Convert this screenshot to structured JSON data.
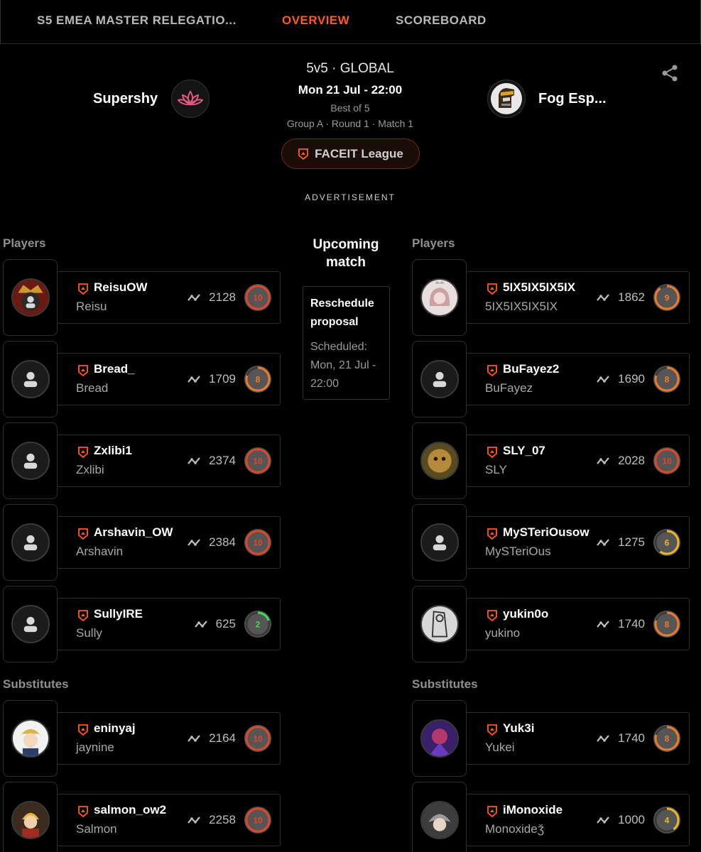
{
  "tabs": [
    {
      "label": "S5 EMEA MASTER RELEGATIO..."
    },
    {
      "label": "OVERVIEW",
      "active": true
    },
    {
      "label": "SCOREBOARD"
    }
  ],
  "match": {
    "team1": {
      "name": "Supershy",
      "logo_icon": "lotus-icon"
    },
    "team2": {
      "name": "Fog Esp...",
      "logo_icon": "knight-helmet-icon"
    },
    "format": "5v5 · GLOBAL",
    "datetime": "Mon 21 Jul - 22:00",
    "best_of": "Best of 5",
    "group_info": "Group A · Round 1 · Match 1",
    "league": "FACEIT League",
    "advertisement": "ADVERTISEMENT"
  },
  "center": {
    "upcoming_label": "Upcoming match",
    "reschedule_title": "Reschedule proposal",
    "reschedule_body": "Scheduled: Mon, 21 Jul - 22:00"
  },
  "labels": {
    "players": "Players",
    "substitutes": "Substitutes"
  },
  "colors": {
    "accent": "#ff5a1f",
    "level_red": "#e0462a",
    "level_orange": "#f07a2c",
    "level_yellow": "#f0b429",
    "level_green": "#3ddc52"
  },
  "team1_players": [
    {
      "nick": "ReisuOW",
      "name": "Reisu",
      "elo": "2128",
      "level": "10",
      "avatar": "crown-photo"
    },
    {
      "nick": "Bread_",
      "name": "Bread",
      "elo": "1709",
      "level": "8",
      "avatar": "default"
    },
    {
      "nick": "Zxlibi1",
      "name": "Zxlibi",
      "elo": "2374",
      "level": "10",
      "avatar": "default"
    },
    {
      "nick": "Arshavin_OW",
      "name": "Arshavin",
      "elo": "2384",
      "level": "10",
      "avatar": "default"
    },
    {
      "nick": "SullyIRE",
      "name": "Sully",
      "elo": "625",
      "level": "2",
      "avatar": "default"
    }
  ],
  "team1_subs": [
    {
      "nick": "eninyaj",
      "name": "jaynine",
      "elo": "2164",
      "level": "10",
      "avatar": "anime-photo"
    },
    {
      "nick": "salmon_ow2",
      "name": "Salmon",
      "elo": "2258",
      "level": "10",
      "avatar": "alchemist-photo"
    }
  ],
  "team2_players": [
    {
      "nick": "5IX5IX5IX5IX",
      "name": "5IX5IX5IX5IX",
      "elo": "1862",
      "level": "9",
      "avatar": "girl-photo"
    },
    {
      "nick": "BuFayez2",
      "name": "BuFayez",
      "elo": "1690",
      "level": "8",
      "avatar": "default"
    },
    {
      "nick": "SLY_07",
      "name": "SLY",
      "elo": "2028",
      "level": "10",
      "avatar": "cat-photo"
    },
    {
      "nick": "MySTeriOusow",
      "name": "MySTeriOus",
      "elo": "1275",
      "level": "6",
      "avatar": "default"
    },
    {
      "nick": "yukin0o",
      "name": "yukino",
      "elo": "1740",
      "level": "8",
      "avatar": "sketch-photo"
    }
  ],
  "team2_subs": [
    {
      "nick": "Yuk3i",
      "name": "Yukei",
      "elo": "1740",
      "level": "8",
      "avatar": "purple-photo"
    },
    {
      "nick": "iMonoxide",
      "name": "Monoxideǯ",
      "elo": "1000",
      "level": "4",
      "avatar": "shark-photo"
    }
  ]
}
